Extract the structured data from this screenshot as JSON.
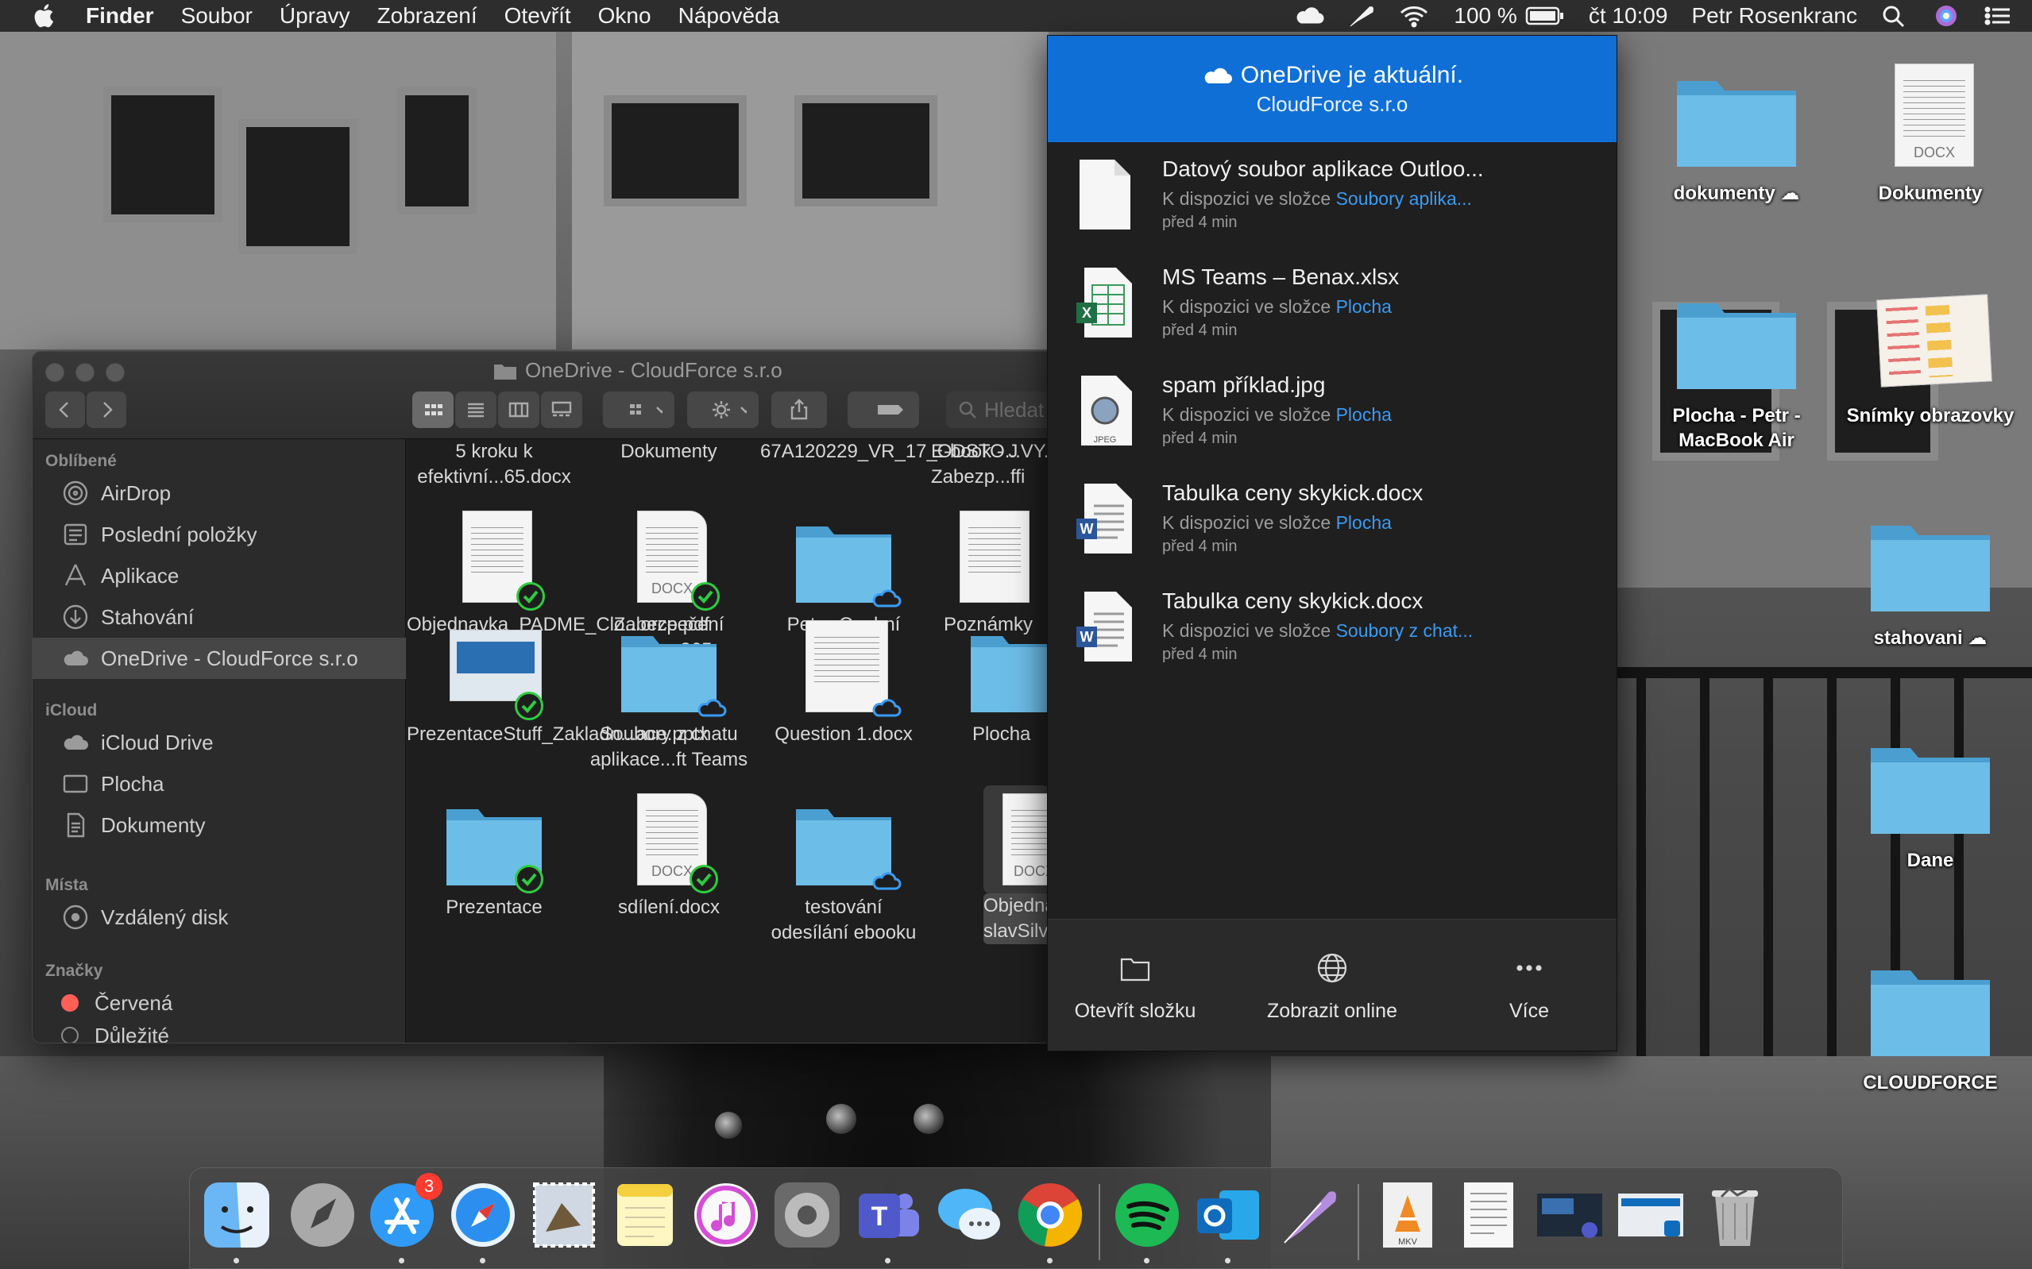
{
  "menubar": {
    "app": "Finder",
    "menus": [
      "Soubor",
      "Úpravy",
      "Zobrazení",
      "Otevřít",
      "Okno",
      "Nápověda"
    ],
    "battery": "100 %",
    "clock": "čt 10:09",
    "user": "Petr Rosenkranc"
  },
  "desktop": {
    "icons": [
      {
        "label": "dokumenty ☁",
        "kind": "folder"
      },
      {
        "label": "Dokumenty",
        "kind": "docx"
      },
      {
        "label": "Plocha - Petr - MacBook Air",
        "kind": "folder"
      },
      {
        "label": "Snímky obrazovky",
        "kind": "image"
      },
      {
        "label": "stahovani ☁",
        "kind": "folder"
      },
      {
        "label": "Dane",
        "kind": "folder"
      },
      {
        "label": "CLOUDFORCE",
        "kind": "folder"
      }
    ]
  },
  "finder": {
    "title": "OneDrive - CloudForce s.r.o",
    "search_placeholder": "Hledat",
    "sidebar": {
      "favorites_header": "Oblíbené",
      "favorites": [
        "AirDrop",
        "Poslední položky",
        "Aplikace",
        "Stahování",
        "OneDrive - CloudForce s.r.o"
      ],
      "icloud_header": "iCloud",
      "icloud": [
        "iCloud Drive",
        "Plocha",
        "Dokumenty"
      ],
      "places_header": "Místa",
      "places": [
        "Vzdálený disk"
      ],
      "tags_header": "Značky",
      "tags": [
        "Červená",
        "Důležité"
      ]
    },
    "top_row": [
      "5 kroku k efektivní...65.docx",
      "Dokumenty",
      "67A120229_VR_17_ODSTO...VY.docx",
      "E-book - J Zabezp...ffi"
    ],
    "files": [
      {
        "name": "Objednavka_PADME_Clo...orce.pdf",
        "type": "pdf",
        "status": "synced"
      },
      {
        "name": "Zabezpečení Office 365",
        "type": "docx",
        "status": "synced"
      },
      {
        "name": "Petr - Osobní",
        "type": "folder",
        "status": "cloud"
      },
      {
        "name": "Poznámky",
        "type": "doc",
        "status": "none"
      },
      {
        "name": "PrezentaceStuff_Zakladn...ace.pptx",
        "type": "pptx",
        "status": "shared"
      },
      {
        "name": "Soubory z chatu aplikace...ft Teams",
        "type": "folder",
        "status": "cloud"
      },
      {
        "name": "Question 1.docx",
        "type": "doc",
        "status": "cloud"
      },
      {
        "name": "Plocha",
        "type": "folder",
        "status": "none"
      },
      {
        "name": "Prezentace",
        "type": "folder",
        "status": "synced"
      },
      {
        "name": "sdílení.docx",
        "type": "docx",
        "status": "synced"
      },
      {
        "name": "testování odesílání ebooku",
        "type": "folder",
        "status": "cloud"
      },
      {
        "name": "Objednavk slavSilv",
        "type": "docx",
        "status": "selected"
      }
    ]
  },
  "onedrive": {
    "status": "OneDrive je aktuální.",
    "account": "CloudForce s.r.o",
    "activity": [
      {
        "name": "Datový soubor aplikace Outloo...",
        "prefix": "K dispozici ve složce ",
        "folder": "Soubory aplika...",
        "time": "před 4 min",
        "icon": "blank"
      },
      {
        "name": "MS Teams – Benax.xlsx",
        "prefix": "K dispozici ve složce ",
        "folder": "Plocha",
        "time": "před 4 min",
        "icon": "xlsx"
      },
      {
        "name": "spam příklad.jpg",
        "prefix": "K dispozici ve složce ",
        "folder": "Plocha",
        "time": "před 4 min",
        "icon": "jpeg"
      },
      {
        "name": "Tabulka ceny skykick.docx",
        "prefix": "K dispozici ve složce ",
        "folder": "Plocha",
        "time": "před 4 min",
        "icon": "docx"
      },
      {
        "name": "Tabulka ceny skykick.docx",
        "prefix": "K dispozici ve složce ",
        "folder": "Soubory z chat...",
        "time": "před 4 min",
        "icon": "docx"
      }
    ],
    "footer": {
      "open_folder": "Otevřít složku",
      "view_online": "Zobrazit online",
      "more": "Více"
    },
    "icon_labels": {
      "jpeg": "JPEG",
      "docx": "DOCX",
      "mkv": "MKV"
    }
  },
  "dock": {
    "apps": [
      "Finder",
      "Launchpad",
      "App Store",
      "Safari",
      "Mail",
      "Notes",
      "iTunes",
      "System Preferences",
      "Microsoft Teams",
      "Messages",
      "Chrome",
      "Spotify",
      "Outlook",
      "Feather",
      "VLC",
      "Document",
      "Screenshot",
      "Screenshot 2",
      "Trash"
    ],
    "appstore_badge": "3"
  },
  "colors": {
    "accent": "#0f6fd6",
    "link": "#3b9bf3",
    "synced": "#2ecc40",
    "folder": "#5fb3e0"
  }
}
